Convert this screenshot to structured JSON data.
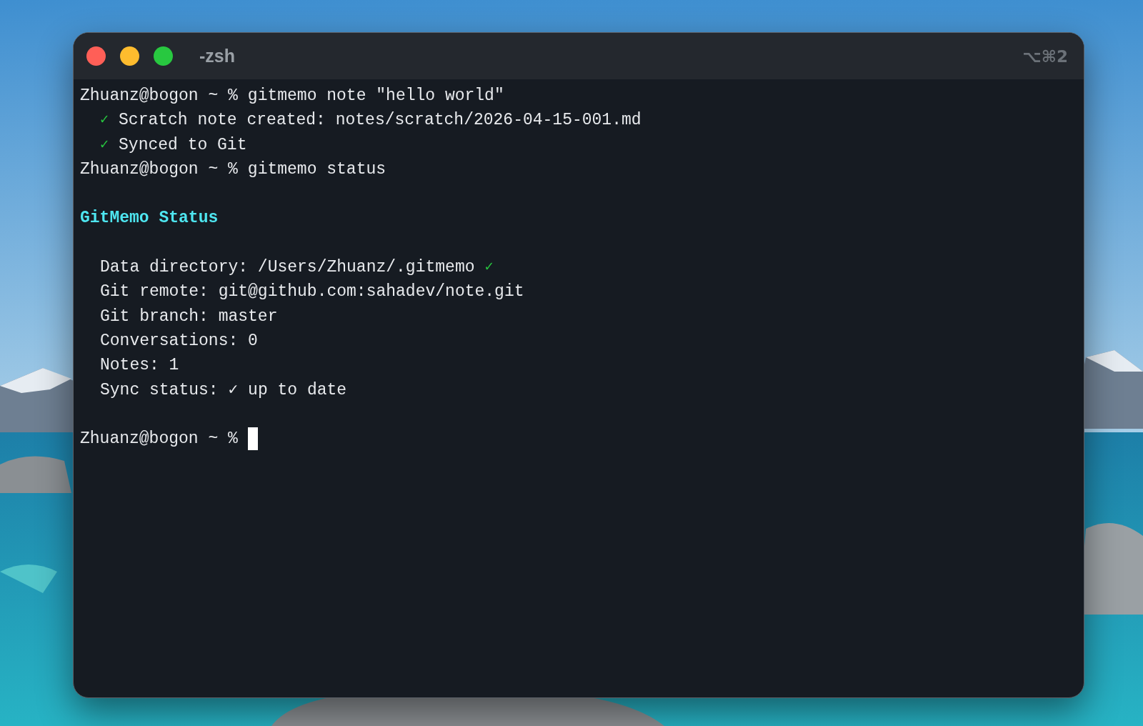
{
  "window": {
    "title": "-zsh",
    "shortcut": "⌥⌘2",
    "buttons": [
      {
        "color": "#ff5f57"
      },
      {
        "color": "#febc2e"
      },
      {
        "color": "#28c840"
      }
    ]
  },
  "lines": [
    {
      "kind": "command",
      "prompt": "Zhuanz@bogon ~ %",
      "command": "gitmemo note \"hello world\""
    },
    {
      "kind": "success",
      "mark": "✓",
      "text": "Scratch note created: notes/scratch/2026-04-15-001.md"
    },
    {
      "kind": "success",
      "mark": "✓",
      "text": "Synced to Git"
    },
    {
      "kind": "command",
      "prompt": "Zhuanz@bogon ~ %",
      "command": "gitmemo status"
    },
    {
      "kind": "blank"
    },
    {
      "kind": "heading",
      "text": "GitMemo Status"
    },
    {
      "kind": "blank"
    },
    {
      "kind": "field",
      "text": "Data directory: /Users/Zhuanz/.gitmemo",
      "mark": "✓"
    },
    {
      "kind": "field",
      "text": "Git remote: git@github.com:sahadev/note.git"
    },
    {
      "kind": "field",
      "text": "Git branch: master"
    },
    {
      "kind": "field",
      "text": "Conversations: 0"
    },
    {
      "kind": "field",
      "text": "Notes: 1"
    },
    {
      "kind": "field",
      "text": "Sync status: ✓ up to date"
    },
    {
      "kind": "blank"
    },
    {
      "kind": "input",
      "prompt": "Zhuanz@bogon ~ %",
      "cursor": true
    }
  ]
}
